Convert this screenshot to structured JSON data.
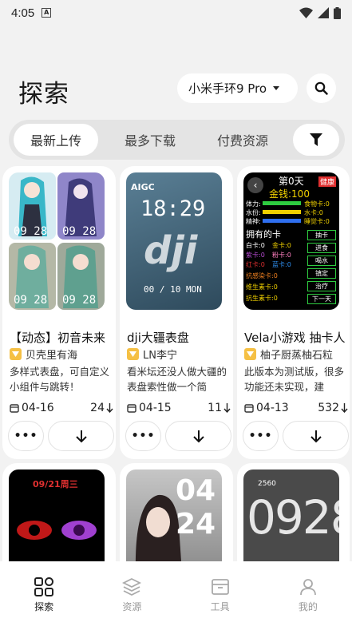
{
  "status_bar": {
    "time": "4:05"
  },
  "page": {
    "title": "探索"
  },
  "device": {
    "selected": "小米手环9 Pro"
  },
  "tabs": [
    {
      "label": "最新上传"
    },
    {
      "label": "最多下载"
    },
    {
      "label": "付费资源"
    }
  ],
  "cards": [
    {
      "title": "【动态】初音未来",
      "author": "贝壳里有海",
      "description": "多样式表盘，可自定义小组件与跳转！",
      "date": "04-16",
      "downloads": "24",
      "thumb_text": [
        "09 28",
        "09 28",
        "09 28",
        "09 28"
      ]
    },
    {
      "title": "dji大疆表盘",
      "author": "LN李宁",
      "description": "看米坛还没人做大疆的表盘索性做一个简",
      "date": "04-15",
      "downloads": "11",
      "thumb_text": [
        "AIGC",
        "18:29",
        "dji",
        "00 / 10  MON"
      ]
    },
    {
      "title": "Vela小游戏 抽卡人",
      "author": "柚子厨蒸柚石粒",
      "description": "此版本为测试版，很多功能还未实现，建",
      "date": "04-13",
      "downloads": "532",
      "thumb_text": {
        "header": "第0天",
        "badge": "健康",
        "money": "金钱:100",
        "stats_left": [
          "体力:",
          "水份:",
          "精神:"
        ],
        "stats_right": [
          "食物卡:0",
          "水卡:0",
          "睡觉卡:0"
        ],
        "owned": "拥有的卡",
        "cards_list": [
          "白卡:0",
          "金卡:0",
          "紫卡:0",
          "粉卡:0",
          "红卡:0",
          "蓝卡:0",
          "抗感染卡:0",
          "维生素卡:0",
          "抗生素卡:0"
        ],
        "buttons": [
          "抽卡",
          "进食",
          "喝水",
          "镇定",
          "治疗",
          "下一天"
        ]
      }
    }
  ],
  "cards_row2": [
    {
      "thumb_text": "09/21周三"
    },
    {
      "thumb_text": [
        "04",
        "24"
      ]
    },
    {
      "thumb_text": [
        "2560",
        "0928"
      ]
    }
  ],
  "bottom_nav": [
    {
      "label": "探索",
      "icon": "explore-icon"
    },
    {
      "label": "资源",
      "icon": "layers-icon"
    },
    {
      "label": "工具",
      "icon": "toolbox-icon"
    },
    {
      "label": "我的",
      "icon": "person-icon"
    }
  ]
}
